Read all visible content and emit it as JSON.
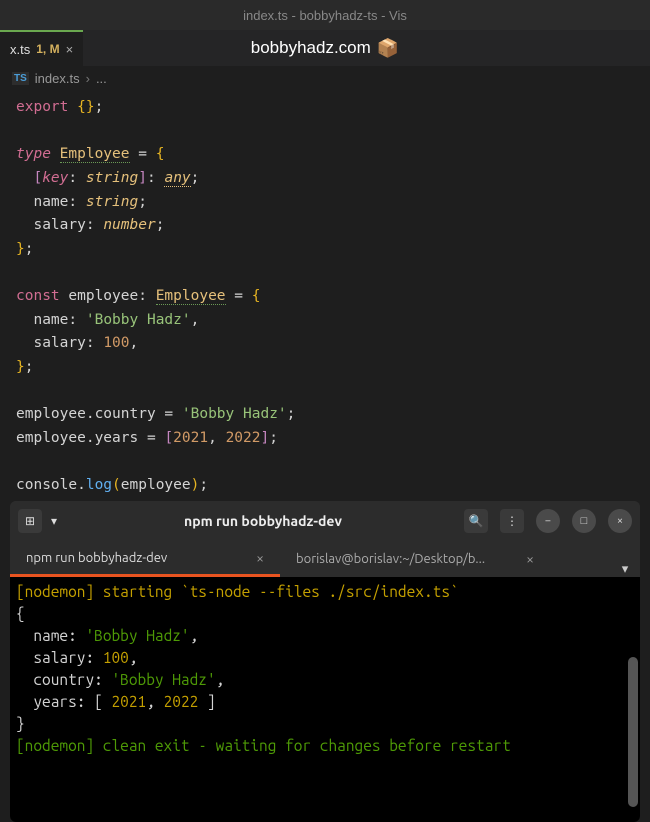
{
  "title_bar": "index.ts - bobbyhadz-ts - Vis",
  "tab": {
    "name": "x.ts",
    "badge": "1, M",
    "close": "×"
  },
  "watermark": "bobbyhadz.com",
  "cube_icon": "📦",
  "breadcrumb": {
    "ts_badge": "TS",
    "file": "index.ts",
    "chevron": "›",
    "dots": "..."
  },
  "code": {
    "export": "export",
    "empty_braces": "{}",
    "semi": ";",
    "type_kw": "type",
    "Employee": "Employee",
    "eq": "=",
    "lbrace": "{",
    "rbrace": "}",
    "lbracket": "[",
    "rbracket": "]",
    "key": "key",
    "colon": ":",
    "string": "string",
    "any": "any",
    "name": "name",
    "salary": "salary",
    "number": "number",
    "const_kw": "const",
    "employee": "employee",
    "bobby_str": "'Bobby Hadz'",
    "comma": ",",
    "hundred": "100",
    "dot": ".",
    "country": "country",
    "years": "years",
    "y2021": "2021",
    "y2022": "2022",
    "console": "console",
    "log": "log",
    "lparen": "(",
    "rparen": ")"
  },
  "terminal": {
    "title": "npm run bobbyhadz-dev",
    "search_icon": "🔍",
    "menu_icon": "⋮",
    "min_icon": "−",
    "max_icon": "□",
    "close_icon": "×",
    "new_tab_icon": "⊞",
    "dropdown_icon": "▾",
    "tabs": [
      {
        "label": "npm run bobbyhadz-dev",
        "active": true
      },
      {
        "label": "borislav@borislav:~/Desktop/b...",
        "active": false
      }
    ],
    "tab_close": "×",
    "tab_arrow": "▾",
    "output": {
      "l1": "[nodemon] starting `ts-node --files ./src/index.ts`",
      "l2": "{",
      "l3a": "  name: ",
      "l3b": "'Bobby Hadz'",
      "l3c": ",",
      "l4a": "  salary: ",
      "l4b": "100",
      "l4c": ",",
      "l5a": "  country: ",
      "l5b": "'Bobby Hadz'",
      "l5c": ",",
      "l6a": "  years: [ ",
      "l6b": "2021",
      "l6c": ", ",
      "l6d": "2022",
      "l6e": " ]",
      "l7": "}",
      "l8": "[nodemon] clean exit - waiting for changes before restart"
    }
  }
}
